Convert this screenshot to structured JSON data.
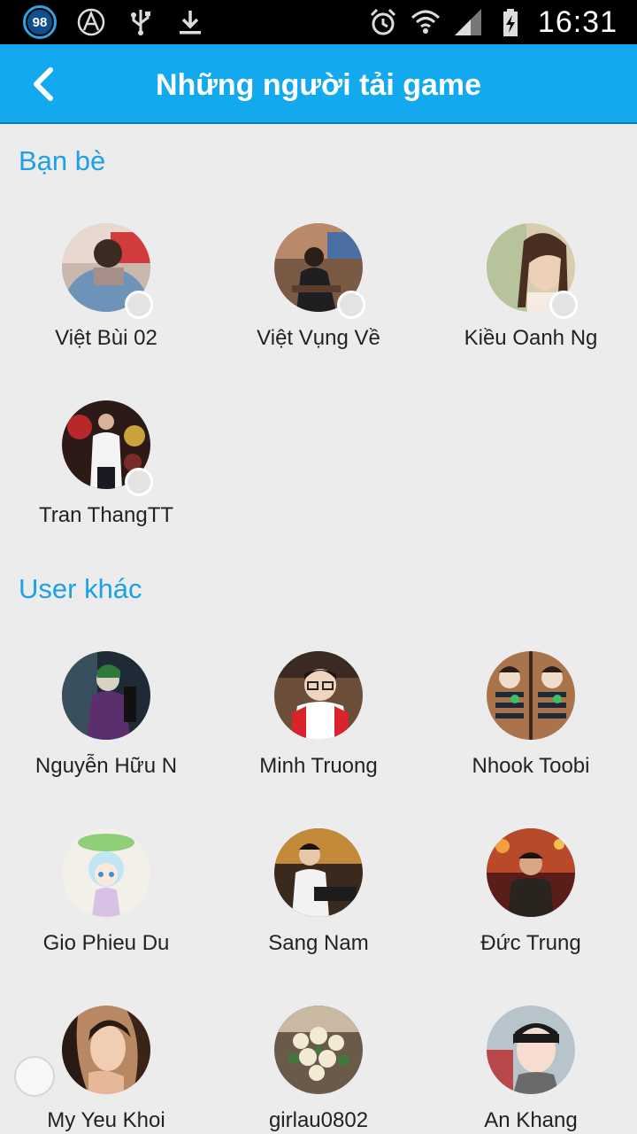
{
  "status_bar": {
    "battery_badge": "98",
    "time": "16:31",
    "icons": [
      "battery-badge-icon",
      "navigation-app-icon",
      "usb-icon",
      "download-icon",
      "alarm-icon",
      "wifi-icon",
      "signal-icon",
      "battery-icon"
    ]
  },
  "app_bar": {
    "title": "Những người tải game",
    "back_icon": "chevron-left-icon"
  },
  "sections": {
    "friends": {
      "title": "Bạn bè",
      "users": [
        {
          "name": "Việt Bùi 02",
          "online": false
        },
        {
          "name": "Việt Vụng Về",
          "online": false
        },
        {
          "name": "Kiều Oanh Ng",
          "online": false
        },
        {
          "name": "Tran ThangTT",
          "online": false
        }
      ]
    },
    "others": {
      "title": "User khác",
      "users": [
        {
          "name": "Nguyễn Hữu N"
        },
        {
          "name": "Minh Truong"
        },
        {
          "name": "Nhook Toobi"
        },
        {
          "name": "Gio Phieu Du"
        },
        {
          "name": "Sang Nam"
        },
        {
          "name": "Đức Trung"
        },
        {
          "name": "My Yeu Khoi"
        },
        {
          "name": "girlau0802"
        },
        {
          "name": "An Khang"
        }
      ]
    }
  },
  "colors": {
    "app_bar": "#13a9ef",
    "section_header": "#1da1e6",
    "background": "#ececec",
    "presence_offline": "#e3e3e3"
  }
}
